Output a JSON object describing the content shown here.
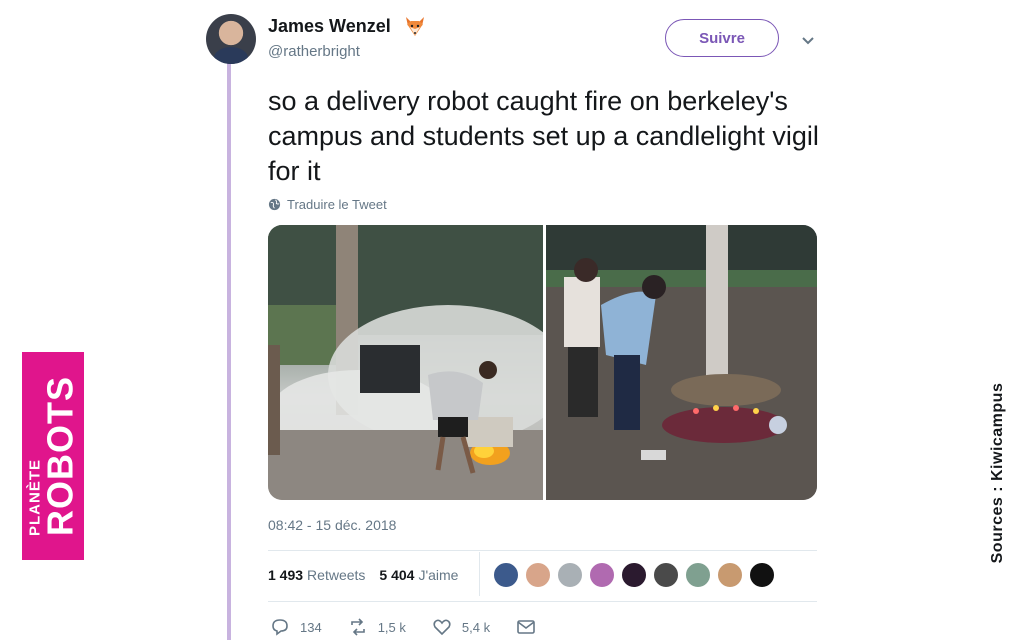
{
  "tweet": {
    "display_name": "James Wenzel",
    "emoji_icon": "fox-face-icon",
    "handle": "@ratherbright",
    "follow_label": "Suivre",
    "text": "so a delivery robot caught fire on berkeley's campus and students set up a candlelight vigil for it",
    "translate_label": "Traduire le Tweet",
    "timestamp": "08:42 - 15 déc. 2018",
    "media": [
      {
        "icon": "photo-robot-fire-icon"
      },
      {
        "icon": "photo-candlelight-vigil-icon"
      }
    ],
    "stats": {
      "retweets_count": "1 493",
      "retweets_label": "Retweets",
      "likes_count": "5 404",
      "likes_label": "J'aime"
    },
    "likers": [
      {
        "icon": "avatar-icon",
        "color": "#3c5a8c"
      },
      {
        "icon": "avatar-icon",
        "color": "#d8a58a"
      },
      {
        "icon": "avatar-icon",
        "color": "#a9b0b5"
      },
      {
        "icon": "avatar-icon",
        "color": "#b06ab0"
      },
      {
        "icon": "avatar-icon",
        "color": "#2b1a2f"
      },
      {
        "icon": "avatar-icon",
        "color": "#4a4a4a"
      },
      {
        "icon": "avatar-icon",
        "color": "#7fa090"
      },
      {
        "icon": "avatar-icon",
        "color": "#c89a70"
      },
      {
        "icon": "avatar-icon",
        "color": "#111111"
      }
    ],
    "actions": {
      "reply_count": "134",
      "retweet_count": "1,5 k",
      "like_count": "5,4 k"
    }
  },
  "brand": {
    "line1": "PLANÈTE",
    "line2": "ROBOTS",
    "color": "#e0158c"
  },
  "sources_label": "Sources : Kiwicampus",
  "colors": {
    "accent": "#7b57b6",
    "thread_line": "#c8b3df",
    "muted_text": "#657786"
  }
}
